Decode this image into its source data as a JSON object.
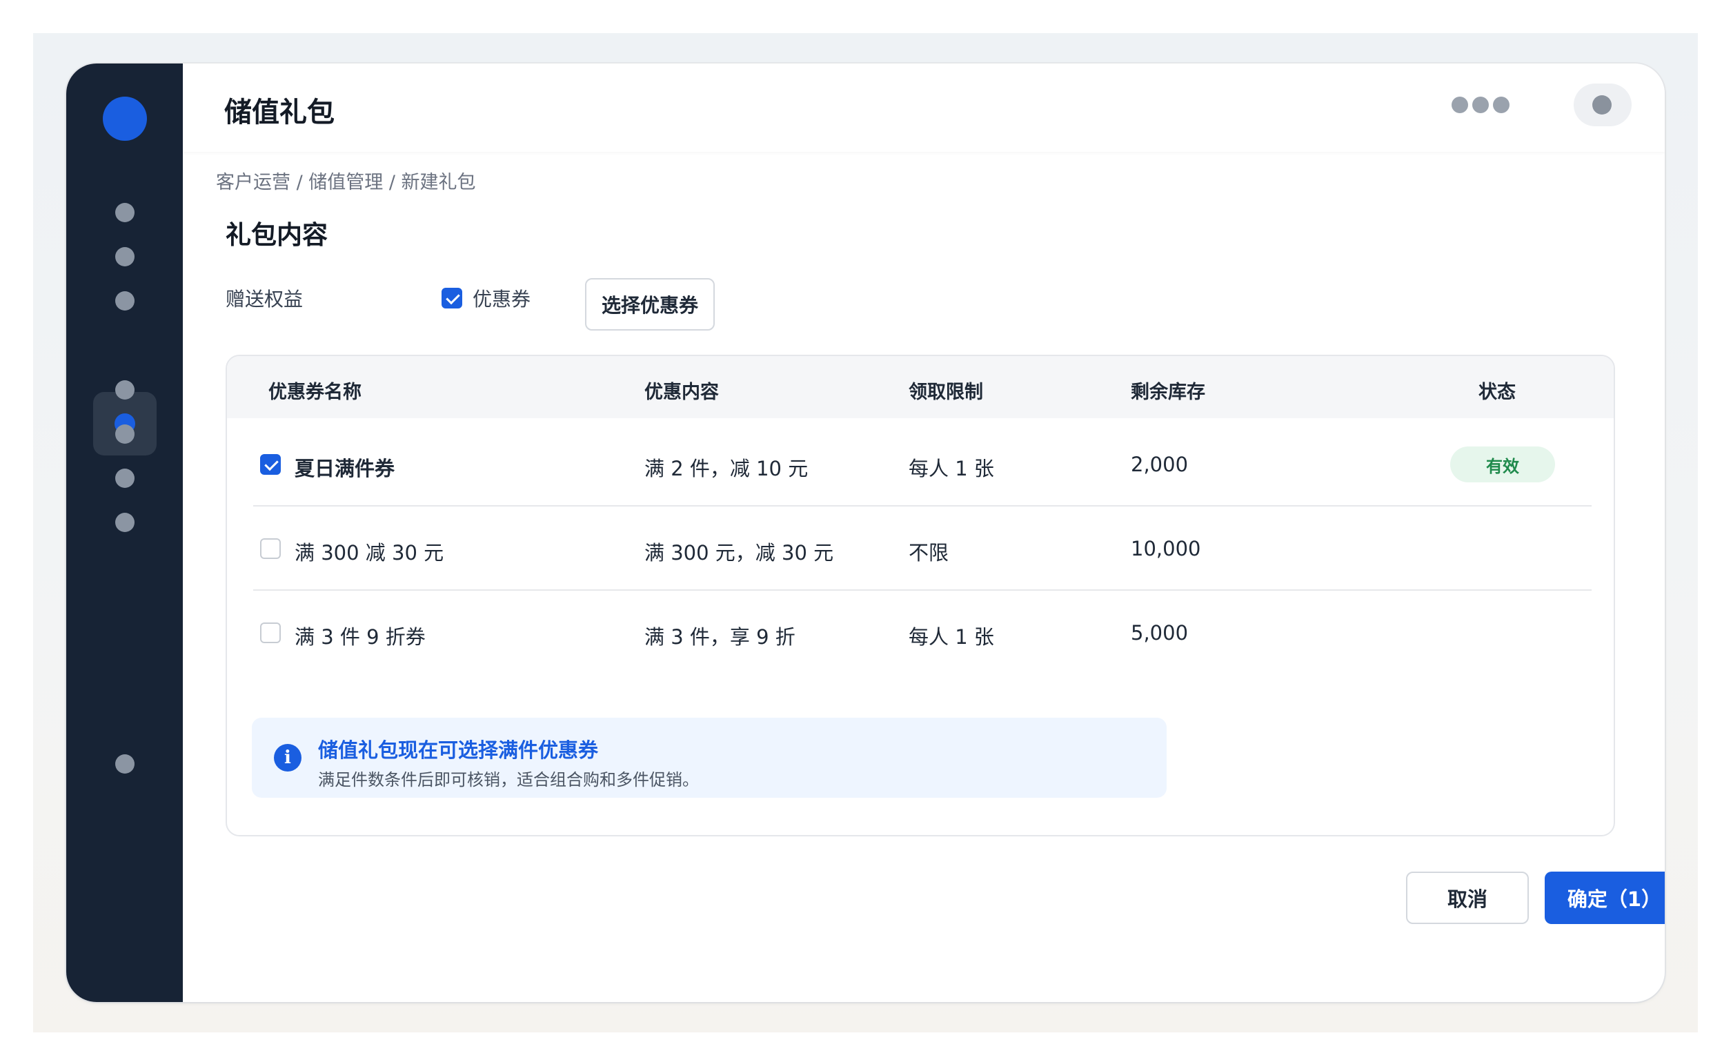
{
  "app": {
    "title": "储值礼包"
  },
  "breadcrumb": "客户运营 / 储值管理 / 新建礼包",
  "section_title": "礼包内容",
  "gift": {
    "label": "赠送权益",
    "checkbox_label": "优惠券",
    "checkbox_checked": true,
    "select_button": "选择优惠券"
  },
  "table": {
    "headers": [
      "优惠券名称",
      "优惠内容",
      "领取限制",
      "剩余库存",
      "状态"
    ],
    "rows": [
      {
        "checked": true,
        "name": "夏日满件券",
        "content": "满 2 件，减 10 元",
        "limit": "每人 1 张",
        "stock": "2,000",
        "status": "有效"
      },
      {
        "checked": false,
        "name": "满 300 减 30 元",
        "content": "满 300 元，减 30 元",
        "limit": "不限",
        "stock": "10,000",
        "status": ""
      },
      {
        "checked": false,
        "name": "满 3 件 9 折券",
        "content": "满 3 件，享 9 折",
        "limit": "每人 1 张",
        "stock": "5,000",
        "status": ""
      }
    ]
  },
  "notice": {
    "icon": "info-icon",
    "title": "储值礼包现在可选择满件优惠券",
    "description": "满足件数条件后即可核销，适合组合购和多件促销。"
  },
  "footer": {
    "cancel_label": "取消",
    "confirm_label": "确定（1）"
  },
  "colors": {
    "accent": "#1a5ee0",
    "sidebar": "#172335",
    "status_active": "#1f8a4c"
  }
}
